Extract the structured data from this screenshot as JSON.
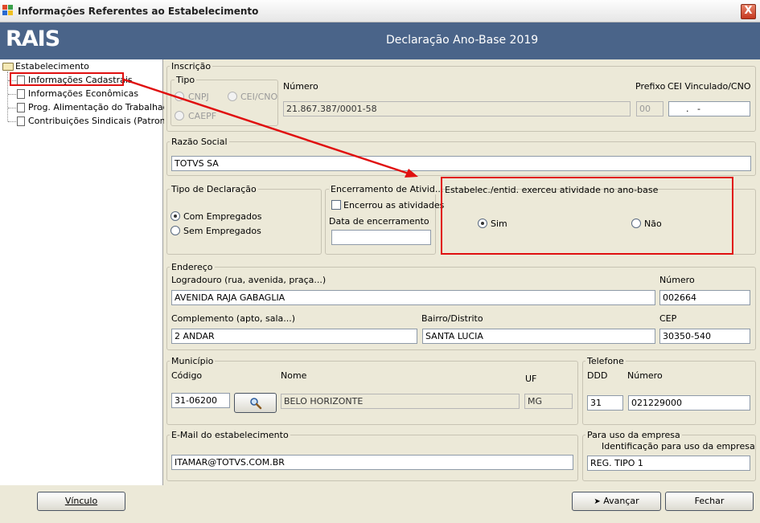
{
  "window": {
    "title": "Informações Referentes ao Estabelecimento",
    "close": "X"
  },
  "header": {
    "logo": "RAIS",
    "title": "Declaração Ano-Base 2019"
  },
  "tree": {
    "root": "Estabelecimento",
    "items": [
      "Informações Cadastrais",
      "Informações Econômicas",
      "Prog. Alimentação do Trabalhador",
      "Contribuições Sindicais (Patronais)"
    ]
  },
  "inscricao": {
    "legend": "Inscrição",
    "tipo_legend": "Tipo",
    "options": [
      "CNPJ",
      "CEI/CNO",
      "CAEPF"
    ],
    "numero_label": "Número",
    "numero_value": "21.867.387/0001-58",
    "prefixo_label": "Prefixo",
    "prefixo_value": "00",
    "cei_label": "CEI Vinculado/CNO",
    "cei_value": "  .   -"
  },
  "razao_social": {
    "legend": "Razão Social",
    "value": "TOTVS SA"
  },
  "tipo_declaracao": {
    "legend": "Tipo de Declaração",
    "options": [
      "Com Empregados",
      "Sem Empregados"
    ]
  },
  "encerramento": {
    "legend": "Encerramento de Ativid...",
    "checkbox_label": "Encerrou as atividades",
    "data_label": "Data de encerramento",
    "data_value": ""
  },
  "atividade": {
    "legend": "Estabelec./entid. exerceu atividade no ano-base",
    "sim": "Sim",
    "nao": "Não"
  },
  "endereco": {
    "legend": "Endereço",
    "logradouro_label": "Logradouro (rua, avenida, praça...)",
    "logradouro_value": "AVENIDA RAJA GABAGLIA",
    "numero_label": "Número",
    "numero_value": "002664",
    "complemento_label": "Complemento (apto, sala...)",
    "complemento_value": "2 ANDAR",
    "bairro_label": "Bairro/Distrito",
    "bairro_value": "SANTA LUCIA",
    "cep_label": "CEP",
    "cep_value": "30350-540"
  },
  "municipio": {
    "legend": "Município",
    "codigo_label": "Código",
    "codigo_value": "31-06200",
    "nome_label": "Nome",
    "nome_value": "BELO HORIZONTE",
    "uf_label": "UF",
    "uf_value": "MG"
  },
  "telefone": {
    "legend": "Telefone",
    "ddd_label": "DDD",
    "ddd_value": "31",
    "numero_label": "Número",
    "numero_value": "021229000"
  },
  "email": {
    "legend": "E-Mail do estabelecimento",
    "value": "ITAMAR@TOTVS.COM.BR"
  },
  "uso_empresa": {
    "legend": "Para uso da empresa",
    "label": "Identificação para uso da empresa",
    "value": "REG. TIPO 1"
  },
  "buttons": {
    "vinculo": "Vínculo",
    "avancar": "Avançar",
    "fechar": "Fechar"
  },
  "colors": {
    "header": "#4a6489",
    "annotation": "#e01010"
  }
}
